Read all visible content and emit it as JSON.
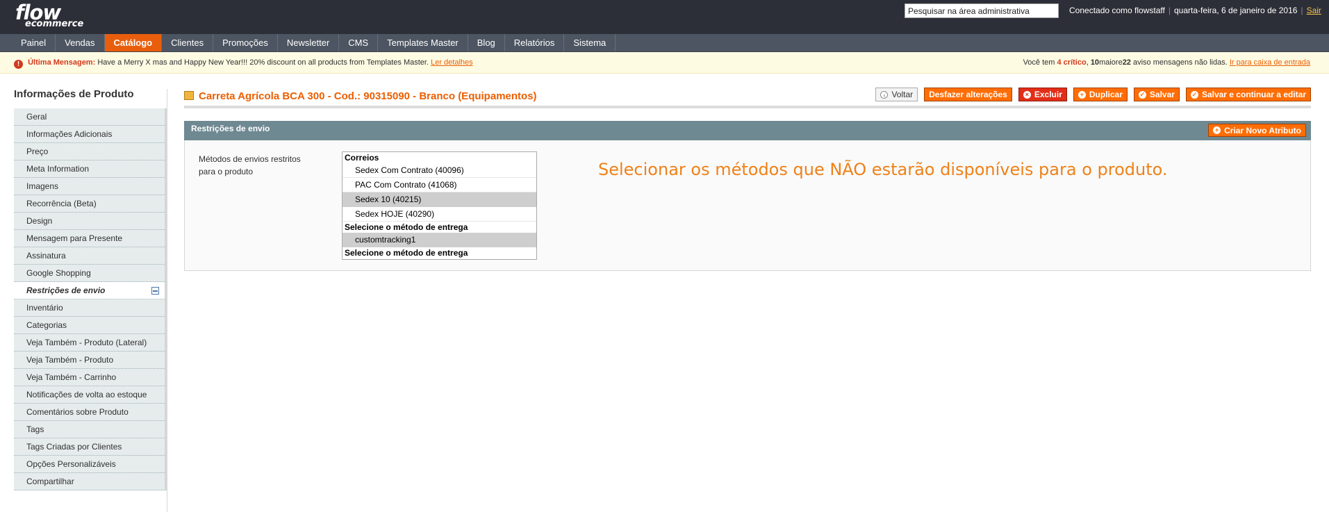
{
  "header": {
    "logo_main": "flow",
    "logo_sub": "ecommerce",
    "search_value": "Pesquisar na área administrativa",
    "user_info": "Conectado como flowstaff",
    "date": "quarta-feira, 6 de janeiro de 2016",
    "logout": "Sair"
  },
  "nav": {
    "items": [
      "Painel",
      "Vendas",
      "Catálogo",
      "Clientes",
      "Promoções",
      "Newsletter",
      "CMS",
      "Templates Master",
      "Blog",
      "Relatórios",
      "Sistema"
    ],
    "active": "Catálogo"
  },
  "message": {
    "icon": "!",
    "label": "Última Mensagem:",
    "text": "Have a Merry X mas and Happy New Year!!! 20% discount on all products from Templates Master.",
    "link": "Ler detalhes",
    "right_prefix": "Você tem",
    "critical_count": "4 crítico",
    "major_count": "10",
    "major_label": "maiore",
    "notice_count": "22",
    "right_suffix": "aviso mensagens não lidas.",
    "inbox_link": "Ir para caixa de entrada"
  },
  "sidebar": {
    "title": "Informações de Produto",
    "tabs": [
      "Geral",
      "Informações Adicionais",
      "Preço",
      "Meta Information",
      "Imagens",
      "Recorrência (Beta)",
      "Design",
      "Mensagem para Presente",
      "Assinatura",
      "Google Shopping",
      "Restrições de envio",
      "Inventário",
      "Categorias",
      "Veja Também - Produto (Lateral)",
      "Veja Também - Produto",
      "Veja Também - Carrinho",
      "Notificações de volta ao estoque",
      "Comentários sobre Produto",
      "Tags",
      "Tags Criadas por Clientes",
      "Opções Personalizáveis",
      "Compartilhar"
    ],
    "active_index": 10
  },
  "page": {
    "title": "Carreta Agrícola BCA 300 - Cod.: 90315090 - Branco (Equipamentos)",
    "buttons": {
      "back": "Voltar",
      "reset": "Desfazer alterações",
      "delete": "Excluir",
      "duplicate": "Duplicar",
      "save": "Salvar",
      "save_continue": "Salvar e continuar a editar"
    }
  },
  "fieldset": {
    "title": "Restrições de envio",
    "new_attribute": "Criar Novo Atributo",
    "field_label": "Métodos de envios restritos para o produto",
    "options": [
      {
        "type": "group",
        "label": "Correios"
      },
      {
        "type": "option",
        "label": "Sedex Com Contrato (40096)",
        "selected": false
      },
      {
        "type": "option",
        "label": "PAC Com Contrato (41068)",
        "selected": false
      },
      {
        "type": "option",
        "label": "Sedex 10 (40215)",
        "selected": true
      },
      {
        "type": "option",
        "label": "Sedex HOJE (40290)",
        "selected": false
      },
      {
        "type": "group",
        "label": "Selecione o método de entrega"
      },
      {
        "type": "option",
        "label": "customtracking1",
        "selected": true
      },
      {
        "type": "group",
        "label": "Selecione o método de entrega"
      }
    ],
    "hint": "Selecionar os métodos que NÃO estarão disponíveis para o produto."
  }
}
